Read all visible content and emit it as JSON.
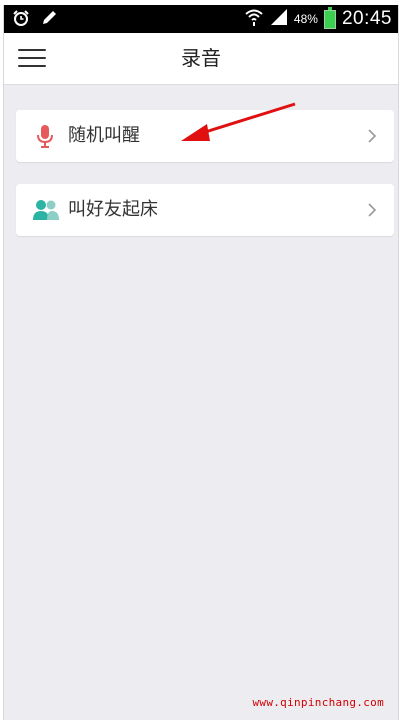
{
  "status_bar": {
    "battery_percent": "48%",
    "time": "20:45",
    "icons": [
      "alarm-icon",
      "pencil-icon",
      "wifi-icon",
      "signal-icon",
      "battery-icon"
    ]
  },
  "app_bar": {
    "title": "录音",
    "menu_icon": "hamburger-menu-icon"
  },
  "menu_items": [
    {
      "label": "随机叫醒",
      "icon": "microphone-icon",
      "icon_color": "#e55b5b"
    },
    {
      "label": "叫好友起床",
      "icon": "people-icon",
      "icon_color": "#2bb3a3"
    }
  ],
  "watermark": "www.qinpinchang.com",
  "colors": {
    "background": "#ececf1",
    "arrow": "#e01010"
  }
}
